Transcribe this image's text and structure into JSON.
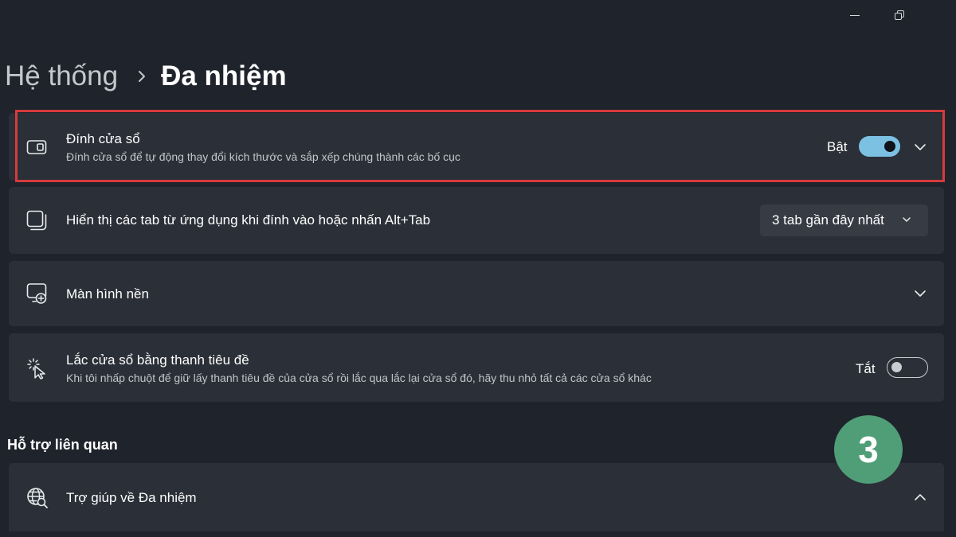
{
  "breadcrumb": {
    "parent": "Hệ thống",
    "current": "Đa nhiệm"
  },
  "settings": {
    "snap_windows": {
      "title": "Đính cửa sổ",
      "description": "Đính cửa sổ để tự động thay đổi kích thước và sắp xếp chúng thành các bố cục",
      "state_label": "Bật",
      "enabled": true,
      "icon": "snap-window-icon"
    },
    "alt_tab": {
      "title": "Hiển thị các tab từ ứng dụng khi đính vào hoặc nhấn Alt+Tab",
      "selected_option": "3 tab gần đây nhất",
      "icon": "tabs-window-icon"
    },
    "desktops": {
      "title": "Màn hình nền",
      "icon": "desktop-add-icon"
    },
    "title_bar_shake": {
      "title": "Lắc cửa sổ bằng thanh tiêu đề",
      "description": "Khi tôi nhấp chuột để giữ lấy thanh tiêu đề của cửa sổ rồi lắc qua lắc lại cửa sổ đó, hãy thu nhỏ tất cả các cửa sổ khác",
      "state_label": "Tắt",
      "enabled": false,
      "icon": "shake-cursor-icon"
    }
  },
  "related_support": {
    "heading": "Hỗ trợ liên quan",
    "items": [
      {
        "title": "Trợ giúp về Đa nhiệm",
        "icon": "globe-search-icon",
        "expanded": true
      }
    ]
  },
  "annotation": {
    "step_number": "3",
    "badge_color": "#4f9e78",
    "highlight_color": "#d63a3d"
  },
  "colors": {
    "background": "#1f232b",
    "card": "#2b2f37",
    "accent": "#7cc1e2"
  }
}
